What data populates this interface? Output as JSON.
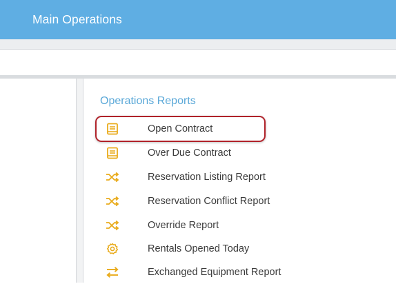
{
  "header": {
    "title": "Main Operations"
  },
  "section": {
    "title": "Operations Reports"
  },
  "reports": [
    {
      "label": "Open Contract",
      "icon": "book-icon"
    },
    {
      "label": "Over Due Contract",
      "icon": "book-icon"
    },
    {
      "label": "Reservation Listing Report",
      "icon": "shuffle-icon"
    },
    {
      "label": "Reservation Conflict Report",
      "icon": "shuffle-icon"
    },
    {
      "label": "Override Report",
      "icon": "shuffle-icon"
    },
    {
      "label": "Rentals Opened Today",
      "icon": "gear-icon"
    },
    {
      "label": "Exchanged Equipment Report",
      "icon": "exchange-icon"
    }
  ],
  "colors": {
    "header_bg": "#5faee3",
    "section_title": "#5aa8d8",
    "icon": "#e9ab1b",
    "highlight": "#b0222a"
  }
}
